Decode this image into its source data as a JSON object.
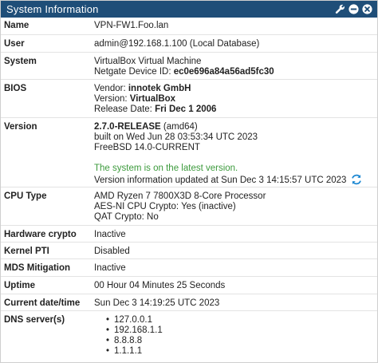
{
  "panel": {
    "title": "System Information",
    "icons": [
      "wrench-icon",
      "minimize-icon",
      "close-icon"
    ]
  },
  "rows": {
    "name": {
      "label": "Name",
      "value": "VPN-FW1.Foo.lan"
    },
    "user": {
      "label": "User",
      "value": "admin@192.168.1.100 (Local Database)"
    },
    "system": {
      "label": "System",
      "line1": "VirtualBox Virtual Machine",
      "line2_prefix": "Netgate Device ID: ",
      "device_id": "ec0e696a84a56ad5fc30"
    },
    "bios": {
      "label": "BIOS",
      "vendor_prefix": "Vendor: ",
      "vendor": "innotek GmbH",
      "version_prefix": "Version: ",
      "version": "VirtualBox",
      "release_prefix": "Release Date: ",
      "release": "Fri Dec 1 2006"
    },
    "version": {
      "label": "Version",
      "release": "2.7.0-RELEASE",
      "arch": " (amd64)",
      "built": "built on Wed Jun 28 03:53:34 UTC 2023",
      "os": "FreeBSD 14.0-CURRENT",
      "status": "The system is on the latest version.",
      "updated": "Version information updated at Sun Dec 3 14:15:57 UTC 2023"
    },
    "cpu": {
      "label": "CPU Type",
      "model": "AMD Ryzen 7 7800X3D 8-Core Processor",
      "aesni": "AES-NI CPU Crypto: Yes (inactive)",
      "qat": "QAT Crypto: No"
    },
    "hwcrypto": {
      "label": "Hardware crypto",
      "value": "Inactive"
    },
    "kpti": {
      "label": "Kernel PTI",
      "value": "Disabled"
    },
    "mds": {
      "label": "MDS Mitigation",
      "value": "Inactive"
    },
    "uptime": {
      "label": "Uptime",
      "value": "00 Hour 04 Minutes 25 Seconds"
    },
    "datetime": {
      "label": "Current date/time",
      "value": "Sun Dec 3 14:19:25 UTC 2023"
    },
    "dns": {
      "label": "DNS server(s)",
      "servers": [
        "127.0.0.1",
        "192.168.1.1",
        "8.8.8.8",
        "1.1.1.1"
      ]
    }
  },
  "colors": {
    "header": "#1f4e78",
    "status_green": "#3c9a3c",
    "refresh_blue": "#1e88d2"
  }
}
